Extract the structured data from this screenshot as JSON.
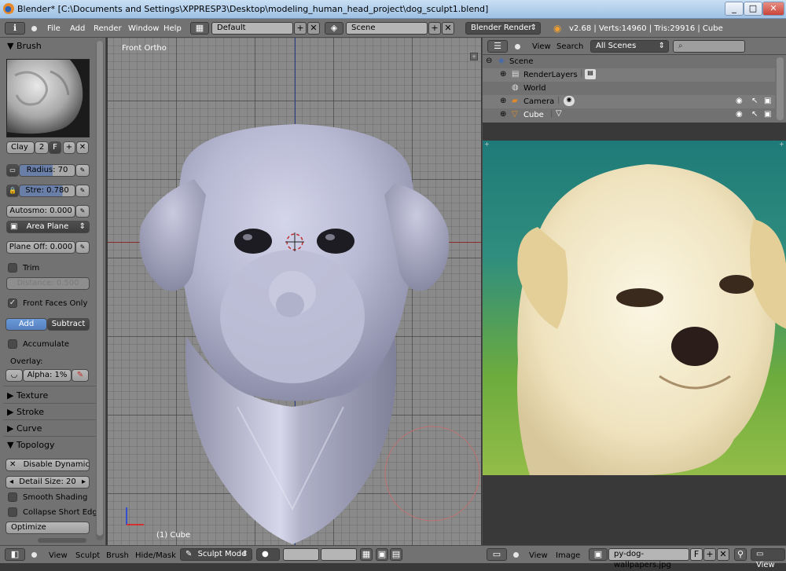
{
  "window": {
    "title": "Blender* [C:\\Documents and Settings\\XPPRESP3\\Desktop\\modeling_human_head_project\\dog_sculpt1.blend]",
    "minimize": "_",
    "maximize": "□",
    "close": "✕"
  },
  "topbar": {
    "menus": [
      "File",
      "Add",
      "Render",
      "Window",
      "Help"
    ],
    "layout": "Default",
    "scene": "Scene",
    "render_engine": "Blender Render",
    "stats": "v2.68 | Verts:14960 | Tris:29916 | Cube"
  },
  "tool_panel": {
    "brush_header": "Brush",
    "brush_name": "Clay",
    "brush_users": "2",
    "brush_fake": "F",
    "radius": "Radius: 70",
    "strength": "Stre: 0.780",
    "autosmooth": "Autosmo: 0.000",
    "area_plane": "Area Plane",
    "plane_offset": "Plane Off: 0.000",
    "trim": "Trim",
    "distance": "Distance: 0.500",
    "front_faces_only": "Front Faces Only",
    "add": "Add",
    "subtract": "Subtract",
    "accumulate": "Accumulate",
    "overlay_label": "Overlay:",
    "alpha": "Alpha: 1%",
    "sections": [
      "Texture",
      "Stroke",
      "Curve",
      "Topology"
    ],
    "disable_dynamic": "Disable Dynamic",
    "detail_size": "Detail Size: 20",
    "smooth_shading": "Smooth Shading",
    "collapse_short_edges": "Collapse Short Edge",
    "optimize": "Optimize"
  },
  "viewport": {
    "view_label": "Front Ortho",
    "object_label": "(1) Cube"
  },
  "outliner": {
    "menus": [
      "View",
      "Search"
    ],
    "scope": "All Scenes",
    "search_placeholder": "",
    "rows": [
      {
        "name": "Scene"
      },
      {
        "name": "RenderLayers"
      },
      {
        "name": "World"
      },
      {
        "name": "Camera"
      },
      {
        "name": "Cube"
      }
    ]
  },
  "image_editor": {
    "menus": [
      "View",
      "Image"
    ],
    "image_name": "py-dog-wallpapers.jpg",
    "fake_flag": "F",
    "view_menu": "View"
  },
  "bottombar": {
    "menus": [
      "View",
      "Sculpt",
      "Brush",
      "Hide/Mask"
    ],
    "mode": "Sculpt Mode"
  }
}
